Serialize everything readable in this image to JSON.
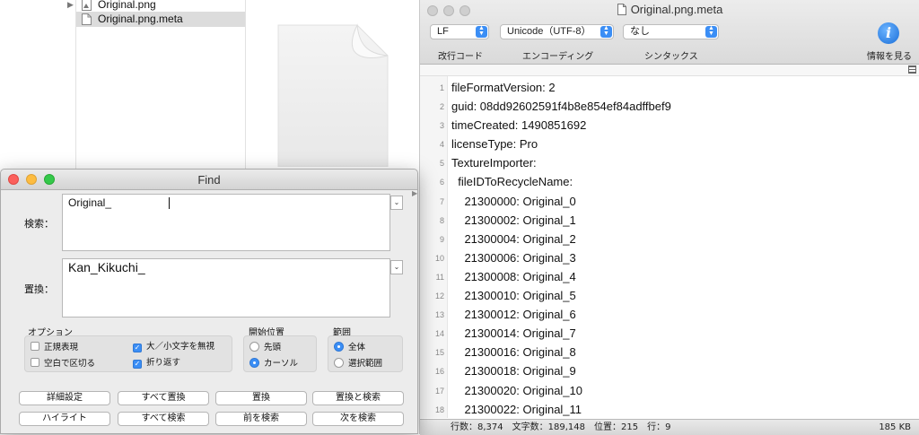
{
  "finder": {
    "items": [
      {
        "name": "Original.png",
        "icon": "image-file-icon"
      },
      {
        "name": "Original.png.meta",
        "icon": "text-file-icon",
        "selected": true
      }
    ]
  },
  "editor": {
    "title": "Original.png.meta",
    "toolbar": {
      "line_ending": {
        "value": "LF",
        "label": "改行コード"
      },
      "encoding": {
        "value": "Unicode（UTF-8）",
        "label": "エンコーディング"
      },
      "syntax": {
        "value": "なし",
        "label": "シンタックス"
      },
      "info_label": "情報を見る"
    },
    "lines": [
      {
        "n": "1",
        "text": "fileFormatVersion: 2"
      },
      {
        "n": "2",
        "text": "guid: 08dd92602591f4b8e854ef84adffbef9"
      },
      {
        "n": "3",
        "text": "timeCreated: 1490851692"
      },
      {
        "n": "4",
        "text": "licenseType: Pro"
      },
      {
        "n": "5",
        "text": "TextureImporter:"
      },
      {
        "n": "6",
        "text": "  fileIDToRecycleName:"
      },
      {
        "n": "7",
        "text": "    21300000: Original_0"
      },
      {
        "n": "8",
        "text": "    21300002: Original_1"
      },
      {
        "n": "9",
        "text": "    21300004: Original_2"
      },
      {
        "n": "10",
        "text": "    21300006: Original_3"
      },
      {
        "n": "11",
        "text": "    21300008: Original_4"
      },
      {
        "n": "12",
        "text": "    21300010: Original_5"
      },
      {
        "n": "13",
        "text": "    21300012: Original_6"
      },
      {
        "n": "14",
        "text": "    21300014: Original_7"
      },
      {
        "n": "15",
        "text": "    21300016: Original_8"
      },
      {
        "n": "16",
        "text": "    21300018: Original_9"
      },
      {
        "n": "17",
        "text": "    21300020: Original_10"
      },
      {
        "n": "18",
        "text": "    21300022: Original_11"
      }
    ],
    "status": {
      "summary": "行数：8,374　文字数：189,148　位置：215　行：9",
      "size": "185 KB"
    }
  },
  "find": {
    "title": "Find",
    "search_label": "検索：",
    "search_value": "Original_",
    "replace_label": "置換：",
    "replace_value": "Kan_Kikuchi_",
    "options": {
      "title": "オプション",
      "regex": "正規表現",
      "ignore_case": "大／小文字を無視",
      "whitespace": "空白で区切る",
      "wrap": "折り返す"
    },
    "start": {
      "title": "開始位置",
      "top": "先頭",
      "cursor": "カーソル"
    },
    "range": {
      "title": "範囲",
      "all": "全体",
      "selection": "選択範囲"
    },
    "buttons": {
      "details": "詳細設定",
      "replace_all": "すべて置換",
      "replace": "置換",
      "replace_find": "置換と検索",
      "highlight": "ハイライト",
      "find_all": "すべて検索",
      "find_prev": "前を検索",
      "find_next": "次を検索"
    }
  }
}
